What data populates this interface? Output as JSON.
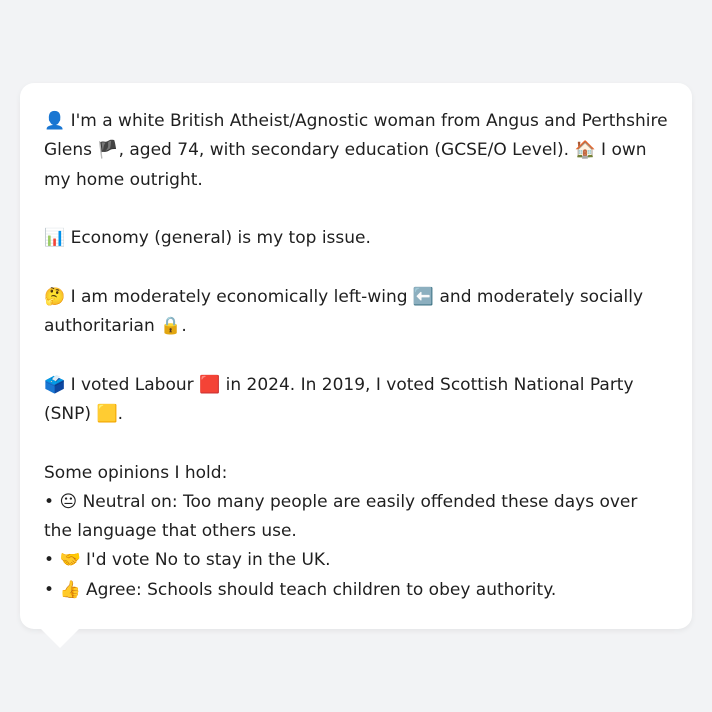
{
  "profile": {
    "line1_emoji": "👤",
    "line1_text": "I'm a white British Atheist/Agnostic woman from Angus and Perthshire Glens",
    "flag_emoji": "🏴",
    "line1_text2": ", aged 74, with secondary education (GCSE/O Level).",
    "home_emoji": "🏠",
    "line1_text3": "I own my home outright."
  },
  "issue": {
    "emoji": "📊",
    "text": "Economy (general) is my top issue."
  },
  "ideology": {
    "emoji": "🤔",
    "text1": "I am moderately economically left-wing",
    "left_emoji": "⬅️",
    "text2": "and moderately socially authoritarian",
    "lock_emoji": "🔒",
    "text3": "."
  },
  "vote": {
    "emoji": "🗳️",
    "text1": "I voted Labour",
    "labour_emoji": "🟥",
    "text2": "in 2024. In 2019, I voted Scottish National Party (SNP)",
    "snp_emoji": "🟨",
    "text3": "."
  },
  "opinions": {
    "header": "Some opinions I hold:",
    "items": [
      {
        "bullet": "•",
        "emoji": "😐",
        "text": "Neutral on: Too many people are easily offended these days over the language that others use."
      },
      {
        "bullet": "•",
        "emoji": "🤝",
        "text": "I'd vote No to stay in the UK."
      },
      {
        "bullet": "•",
        "emoji": "👍",
        "text": "Agree: Schools should teach children to obey authority."
      }
    ]
  }
}
